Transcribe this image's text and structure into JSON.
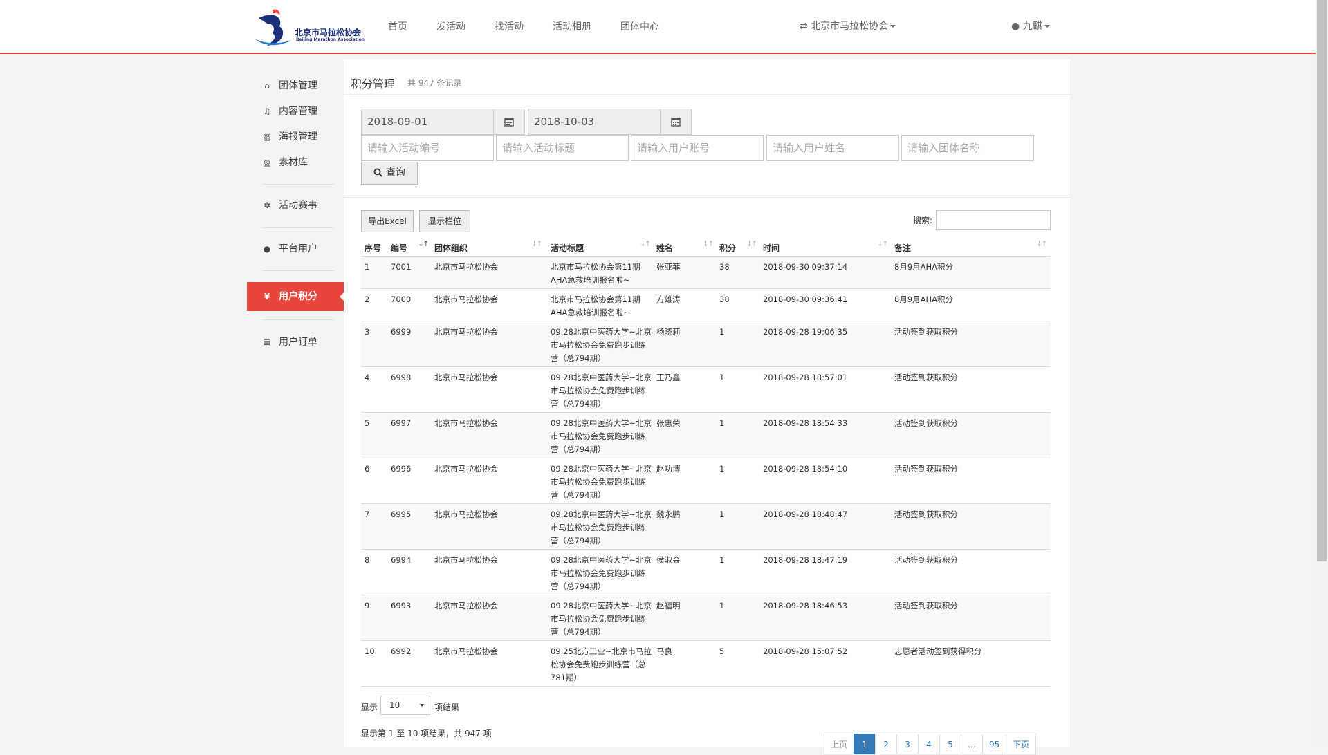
{
  "header": {
    "logo_cn": "北京市马拉松协会",
    "logo_en": "Beijing Marathon Association",
    "nav": [
      "首页",
      "发活动",
      "找活动",
      "活动相册",
      "团体中心"
    ],
    "org_switch": "⇄ 北京市马拉松协会",
    "user": "九麒"
  },
  "sidebar": {
    "items": [
      {
        "icon": "home-icon",
        "glyph": "⌂",
        "label": "团体管理"
      },
      {
        "icon": "bell-icon",
        "glyph": "♫",
        "label": "内容管理"
      },
      {
        "icon": "image-icon",
        "glyph": "▨",
        "label": "海报管理"
      },
      {
        "icon": "image-icon",
        "glyph": "▨",
        "label": "素材库"
      },
      {
        "icon": "gear-icon",
        "glyph": "✲",
        "label": "活动赛事"
      },
      {
        "icon": "user-icon",
        "glyph": "●",
        "label": "平台用户"
      },
      {
        "icon": "yen-icon",
        "glyph": "¥",
        "label": "用户积分"
      },
      {
        "icon": "file-icon",
        "glyph": "▤",
        "label": "用户订单"
      }
    ]
  },
  "main": {
    "title": "积分管理",
    "count": "共 947 条记录",
    "date_from": "2018-09-01",
    "date_to": "2018-10-03",
    "placeholders": {
      "activity_no": "请输入活动编号",
      "activity_title": "请输入活动标题",
      "user_account": "请输入用户账号",
      "user_name": "请输入用户姓名",
      "group_name": "请输入团体名称"
    },
    "query_button": "查询",
    "export_button": "导出Excel",
    "columns_button": "显示栏位",
    "search_label": "搜索:"
  },
  "table": {
    "headers": [
      "序号",
      "编号",
      "团体组织",
      "活动标题",
      "姓名",
      "积分",
      "时间",
      "备注"
    ],
    "rows": [
      {
        "seq": "1",
        "id": "7001",
        "org": "北京市马拉松协会",
        "title": [
          "北京市马拉松协会第11期",
          "AHA急救培训报名啦~"
        ],
        "name": "张亚菲",
        "points": "38",
        "time": "2018-09-30 09:37:14",
        "note": "8月9月AHA积分"
      },
      {
        "seq": "2",
        "id": "7000",
        "org": "北京市马拉松协会",
        "title": [
          "北京市马拉松协会第11期",
          "AHA急救培训报名啦~"
        ],
        "name": "方雄涛",
        "points": "38",
        "time": "2018-09-30 09:36:41",
        "note": "8月9月AHA积分"
      },
      {
        "seq": "3",
        "id": "6999",
        "org": "北京市马拉松协会",
        "title": [
          "09.28北京中医药大学~北京",
          "市马拉松协会免费跑步训练",
          "营（总794期）"
        ],
        "name": "杨晓莉",
        "points": "1",
        "time": "2018-09-28 19:06:35",
        "note": "活动签到获取积分"
      },
      {
        "seq": "4",
        "id": "6998",
        "org": "北京市马拉松协会",
        "title": [
          "09.28北京中医药大学~北京",
          "市马拉松协会免费跑步训练",
          "营（总794期）"
        ],
        "name": "王乃鑫",
        "points": "1",
        "time": "2018-09-28 18:57:01",
        "note": "活动签到获取积分"
      },
      {
        "seq": "5",
        "id": "6997",
        "org": "北京市马拉松协会",
        "title": [
          "09.28北京中医药大学~北京",
          "市马拉松协会免费跑步训练",
          "营（总794期）"
        ],
        "name": "张惠荣",
        "points": "1",
        "time": "2018-09-28 18:54:33",
        "note": "活动签到获取积分"
      },
      {
        "seq": "6",
        "id": "6996",
        "org": "北京市马拉松协会",
        "title": [
          "09.28北京中医药大学~北京",
          "市马拉松协会免费跑步训练",
          "营（总794期）"
        ],
        "name": "赵功博",
        "points": "1",
        "time": "2018-09-28 18:54:10",
        "note": "活动签到获取积分"
      },
      {
        "seq": "7",
        "id": "6995",
        "org": "北京市马拉松协会",
        "title": [
          "09.28北京中医药大学~北京",
          "市马拉松协会免费跑步训练",
          "营（总794期）"
        ],
        "name": "魏永鹏",
        "points": "1",
        "time": "2018-09-28 18:48:47",
        "note": "活动签到获取积分"
      },
      {
        "seq": "8",
        "id": "6994",
        "org": "北京市马拉松协会",
        "title": [
          "09.28北京中医药大学~北京",
          "市马拉松协会免费跑步训练",
          "营（总794期）"
        ],
        "name": "侯淑会",
        "points": "1",
        "time": "2018-09-28 18:47:19",
        "note": "活动签到获取积分"
      },
      {
        "seq": "9",
        "id": "6993",
        "org": "北京市马拉松协会",
        "title": [
          "09.28北京中医药大学~北京",
          "市马拉松协会免费跑步训练",
          "营（总794期）"
        ],
        "name": "赵福明",
        "points": "1",
        "time": "2018-09-28 18:46:53",
        "note": "活动签到获取积分"
      },
      {
        "seq": "10",
        "id": "6992",
        "org": "北京市马拉松协会",
        "title": [
          "09.25北方工业~北京市马拉",
          "松协会免费跑步训练营（总",
          "781期）"
        ],
        "name": "马良",
        "points": "5",
        "time": "2018-09-28 15:07:52",
        "note": "志愿者活动签到获得积分"
      }
    ]
  },
  "footer": {
    "length_prefix": "显示",
    "length_value": "10",
    "length_suffix": "项结果",
    "info": "显示第 1 至 10 项结果，共 947 项",
    "pages": [
      "上页",
      "1",
      "2",
      "3",
      "4",
      "5",
      "…",
      "95",
      "下页"
    ],
    "current_page": "1"
  },
  "colors": {
    "accent": "#e8453c",
    "link": "#337ab7"
  }
}
